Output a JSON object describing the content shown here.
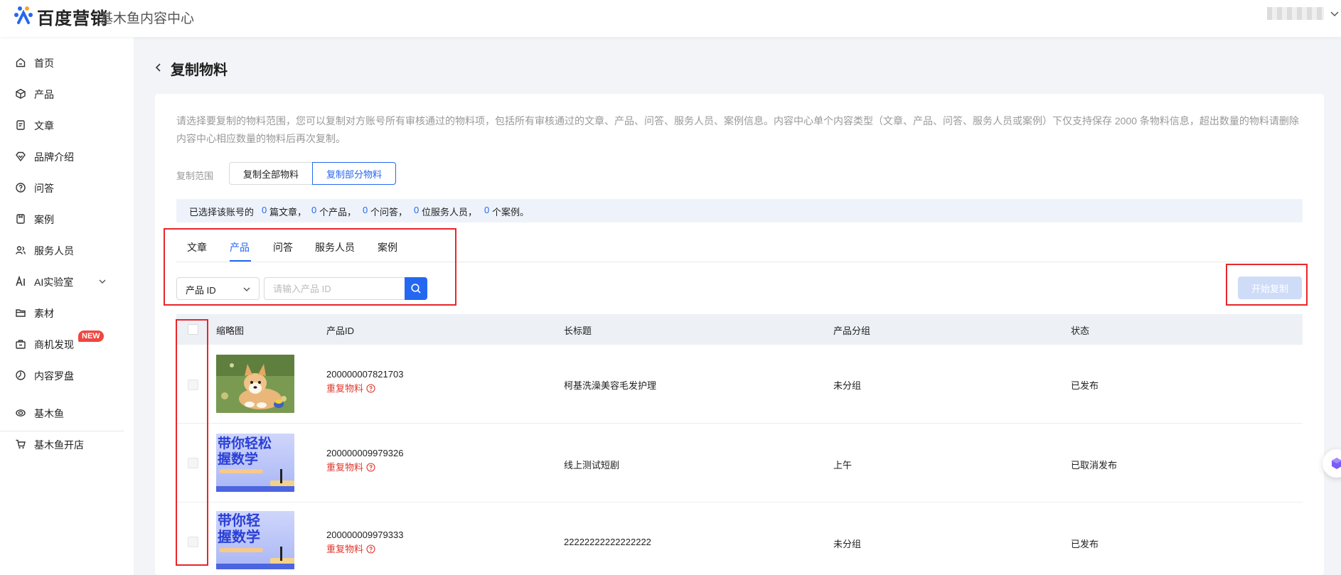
{
  "header": {
    "logo_text": "百度营销",
    "subtitle": "基木鱼内容中心"
  },
  "sidebar": {
    "items": [
      {
        "label": "首页",
        "icon": "home-icon"
      },
      {
        "label": "产品",
        "icon": "box-icon"
      },
      {
        "label": "文章",
        "icon": "document-icon"
      },
      {
        "label": "品牌介绍",
        "icon": "diamond-icon"
      },
      {
        "label": "问答",
        "icon": "question-icon"
      },
      {
        "label": "案例",
        "icon": "clipboard-icon"
      },
      {
        "label": "服务人员",
        "icon": "people-icon"
      },
      {
        "label": "AI实验室",
        "icon": "ai-icon"
      },
      {
        "label": "素材",
        "icon": "folder-icon"
      },
      {
        "label": "商机发现",
        "icon": "briefcase-icon"
      },
      {
        "label": "内容罗盘",
        "icon": "compass-icon"
      },
      {
        "label": "基木鱼",
        "icon": "fish-icon"
      },
      {
        "label": "基木鱼开店",
        "icon": "cart-icon"
      }
    ],
    "new_badge": "NEW"
  },
  "page": {
    "title": "复制物料",
    "description": "请选择要复制的物料范围，您可以复制对方账号所有审核通过的物料项，包括所有审核通过的文章、产品、问答、服务人员、案例信息。内容中心单个内容类型（文章、产品、问答、服务人员或案例）下仅支持保存 2000 条物料信息，超出数量的物料请删除内容中心相应数量的物料后再次复制。",
    "scope_label": "复制范围",
    "scope_all": "复制全部物料",
    "scope_part": "复制部分物料",
    "summary": {
      "prefix": "已选择该账号的",
      "articles_count": "0",
      "articles_unit": "篇文章，",
      "products_count": "0",
      "products_unit": "个产品，",
      "qa_count": "0",
      "qa_unit": "个问答，",
      "staff_count": "0",
      "staff_unit": "位服务人员，",
      "cases_count": "0",
      "cases_unit": "个案例。"
    },
    "tabs": [
      "文章",
      "产品",
      "问答",
      "服务人员",
      "案例"
    ],
    "active_tab": "产品",
    "search_type": "产品 ID",
    "search_placeholder": "请输入产品 ID",
    "start_button": "开始复制"
  },
  "table": {
    "headers": {
      "thumbnail": "缩略图",
      "product_id": "产品ID",
      "long_title": "长标题",
      "group": "产品分组",
      "status": "状态"
    },
    "rows": [
      {
        "thumbnail": "corgi-puppy-photo",
        "product_id": "200000007821703",
        "dup_label": "重复物料",
        "long_title": "柯基洗澡美容毛发护理",
        "group": "未分组",
        "status": "已发布"
      },
      {
        "thumbnail": "math-course-banner",
        "product_id": "200000009979326",
        "dup_label": "重复物料",
        "long_title": "线上测试短剧",
        "group": "上午",
        "status": "已取消发布"
      },
      {
        "thumbnail": "math-course-banner",
        "product_id": "200000009979333",
        "dup_label": "重复物料",
        "long_title": "22222222222222222",
        "group": "未分组",
        "status": "已发布"
      }
    ],
    "banner_text_1": "带你轻松",
    "banner_text_2": "握数学",
    "banner_text_3": "带你轻",
    "banner_text_4": "握数学"
  },
  "colors": {
    "primary": "#2468f2",
    "highlight_red": "#e8262a",
    "duplicate_red": "#e0362b",
    "summary_bg": "#eef3fb"
  }
}
